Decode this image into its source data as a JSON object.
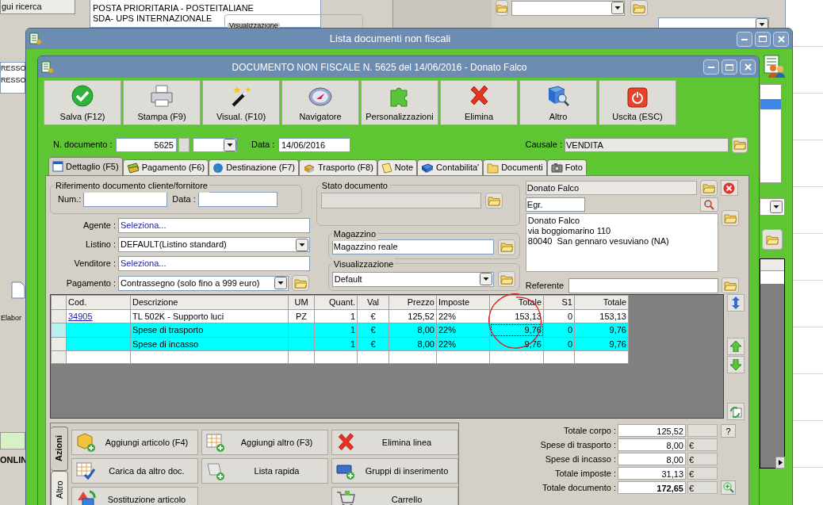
{
  "background": {
    "search_button": "gui ricerca",
    "carriers": [
      "POSTA PRIORITARIA - POSTEITALIANE",
      "SDA- UPS INTERNAZIONALE"
    ],
    "group_title": "Visualizzazione",
    "left_list": [
      "RESSO",
      "RESSO"
    ],
    "left_label": "Elabor",
    "left_status": "ONLIN"
  },
  "outer_window": {
    "title": "Lista documenti non fiscali"
  },
  "document_window": {
    "title": "DOCUMENTO NON FISCALE N. 5625 del 14/06/2016 - Donato Falco",
    "toolbar": [
      "Salva (F12)",
      "Stampa (F9)",
      "Visual. (F10)",
      "Navigatore",
      "Personalizzazioni",
      "Elimina",
      "Altro",
      "Uscita (ESC)"
    ],
    "header": {
      "number_label": "N. documento :",
      "number": "5625",
      "date_label": "Data :",
      "date": "14/06/2016",
      "causale_label": "Causale :",
      "causale": "VENDITA"
    },
    "tabs": [
      {
        "label": "Dettaglio (F5)",
        "selected": true
      },
      {
        "label": "Pagamento (F6)",
        "selected": false
      },
      {
        "label": "Destinazione (F7)",
        "selected": false
      },
      {
        "label": "Trasporto (F8)",
        "selected": false
      },
      {
        "label": "Note",
        "selected": false
      },
      {
        "label": "Contabilita'",
        "selected": false
      },
      {
        "label": "Documenti",
        "selected": false
      },
      {
        "label": "Foto",
        "selected": false
      }
    ],
    "reference": {
      "title": "Riferimento documento cliente/fornitore",
      "num_label": "Num.:",
      "date_label": "Data :"
    },
    "fields": [
      {
        "label": "Agente :",
        "value": "Seleziona...",
        "kind": "link"
      },
      {
        "label": "Listino :",
        "value": "DEFAULT(Listino standard)",
        "kind": "dropdown"
      },
      {
        "label": "Venditore :",
        "value": "Seleziona...",
        "kind": "link"
      },
      {
        "label": "Pagamento :",
        "value": "Contrassegno (solo fino a 999 euro)",
        "kind": "dropdown_folder"
      }
    ],
    "stato": {
      "title": "Stato documento"
    },
    "magazzino": {
      "title": "Magazzino",
      "value": "Magazzino reale"
    },
    "visualizzazione": {
      "title": "Visualizzazione",
      "value": "Default"
    },
    "customer": {
      "name": "Donato Falco",
      "salutation": "Egr.",
      "address": [
        "Donato Falco",
        "via boggiomarino 110",
        "80040  San gennaro vesuviano (NA)"
      ],
      "referente_label": "Referente"
    },
    "table": {
      "columns": [
        "Cod.",
        "Descrizione",
        "UM",
        "Quant.",
        "Val",
        "Prezzo",
        "Imposte",
        "Totale",
        "S1",
        "Totale"
      ],
      "rows": [
        {
          "cells": [
            "34905",
            "TL 502K - Supporto luci",
            "PZ",
            "1",
            "€",
            "125,52",
            "22%",
            "153,13",
            "0",
            "153,13"
          ],
          "highlighted": false,
          "focused": false
        },
        {
          "cells": [
            "",
            "Spese di trasporto",
            "",
            "1",
            "€",
            "8,00",
            "22%",
            "9,76",
            "0",
            "9,76"
          ],
          "highlighted": true,
          "focused": true
        },
        {
          "cells": [
            "",
            "Spese di incasso",
            "",
            "1",
            "€",
            "8,00",
            "22%",
            "9,76",
            "0",
            "9,76"
          ],
          "highlighted": true,
          "focused": false
        }
      ]
    },
    "action_tabs": [
      {
        "label": "Azioni",
        "selected": true
      },
      {
        "label": "Altro",
        "selected": false
      }
    ],
    "action_columns": [
      [
        "Aggiungi articolo (F4)",
        "Carica da altro doc.",
        "Sostituzione articolo"
      ],
      [
        "Aggiungi altro (F3)",
        "Lista rapida"
      ],
      [
        "Elimina linea",
        "Gruppi di inserimento",
        "Carrello"
      ]
    ],
    "totals": [
      {
        "label": "Totale corpo :",
        "value": "125,52",
        "kind": "help",
        "button": "?",
        "bold": false
      },
      {
        "label": "Spese di trasporto :",
        "value": "8,00",
        "unit": "€",
        "kind": "plain",
        "bold": false
      },
      {
        "label": "Spese di incasso :",
        "value": "8,00",
        "unit": "€",
        "kind": "plain",
        "bold": false
      },
      {
        "label": "Totale imposte :",
        "value": "31,13",
        "unit": "€",
        "kind": "plain",
        "bold": false
      },
      {
        "label": "Totale documento :",
        "value": "172,65",
        "unit": "€",
        "kind": "zoom",
        "bold": true
      }
    ]
  }
}
